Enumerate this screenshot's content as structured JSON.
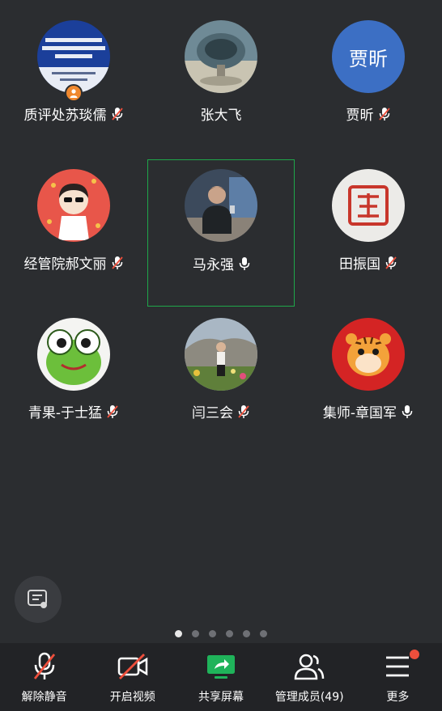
{
  "participants": [
    {
      "name": "质评处苏琰儒",
      "mic": "muted",
      "avatar": "conference-poster",
      "avatar_text": "南宁师范学院师范专业认证工作研讨会",
      "host": true
    },
    {
      "name": "张大飞",
      "mic": "none",
      "avatar": "telescope-photo"
    },
    {
      "name": "贾昕",
      "mic": "muted",
      "avatar": "initials",
      "avatar_text": "贾昕",
      "avatar_color": "#3c6fc4"
    },
    {
      "name": "经管院郝文丽",
      "mic": "muted",
      "avatar": "cartoon-girl"
    },
    {
      "name": "马永强",
      "mic": "on",
      "avatar": "man-photo",
      "speaking": true
    },
    {
      "name": "田振国",
      "mic": "muted",
      "avatar": "seal-stamp"
    },
    {
      "name": "青果-于士猛",
      "mic": "muted",
      "avatar": "frog-cartoon"
    },
    {
      "name": "闫三会",
      "mic": "muted",
      "avatar": "woman-garden-photo"
    },
    {
      "name": "集师-章国军",
      "mic": "on",
      "avatar": "tiger-toy"
    }
  ],
  "pager": {
    "pages": 6,
    "current": 1
  },
  "toolbar": {
    "unmute": "解除静音",
    "start_video": "开启视频",
    "share_screen": "共享屏幕",
    "manage_members": "管理成员(49)",
    "more": "更多"
  },
  "colors": {
    "background": "#2b2d30",
    "speaking_border": "#1fa64a",
    "share_green": "#1fb35a",
    "muted_red": "#ee4f3c",
    "initials_avatar": "#3c6fc4"
  }
}
